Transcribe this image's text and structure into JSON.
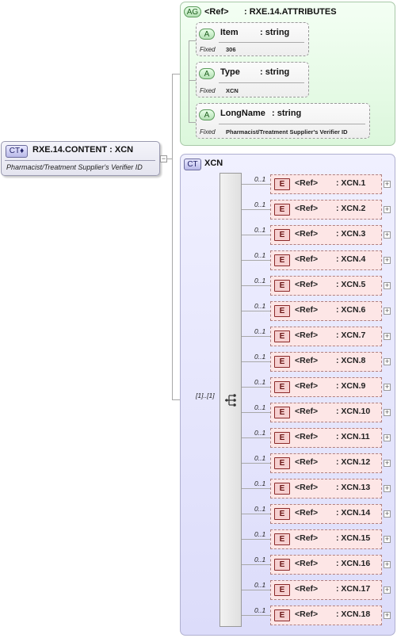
{
  "root": {
    "badge": "CT",
    "title": "RXE.14.CONTENT : XCN",
    "description": "Pharmacist/Treatment Supplier's Verifier ID"
  },
  "attribute_group": {
    "badge": "AG",
    "ref": "<Ref>",
    "name": ": RXE.14.ATTRIBUTES",
    "attributes": [
      {
        "badge": "A",
        "name": "Item",
        "type": ": string",
        "fixed_label": "Fixed",
        "fixed_value": "306"
      },
      {
        "badge": "A",
        "name": "Type",
        "type": ": string",
        "fixed_label": "Fixed",
        "fixed_value": "XCN"
      },
      {
        "badge": "A",
        "name": "LongName",
        "type": ": string",
        "fixed_label": "Fixed",
        "fixed_value": "Pharmacist/Treatment Supplier's Verifier ID"
      }
    ]
  },
  "complex_type": {
    "badge": "CT",
    "name": "XCN",
    "sequence_occurrence": "[1]..[1]",
    "elements": [
      {
        "badge": "E",
        "ref": "<Ref>",
        "type": ": XCN.1",
        "occurrence": "0..1"
      },
      {
        "badge": "E",
        "ref": "<Ref>",
        "type": ": XCN.2",
        "occurrence": "0..1"
      },
      {
        "badge": "E",
        "ref": "<Ref>",
        "type": ": XCN.3",
        "occurrence": "0..1"
      },
      {
        "badge": "E",
        "ref": "<Ref>",
        "type": ": XCN.4",
        "occurrence": "0..1"
      },
      {
        "badge": "E",
        "ref": "<Ref>",
        "type": ": XCN.5",
        "occurrence": "0..1"
      },
      {
        "badge": "E",
        "ref": "<Ref>",
        "type": ": XCN.6",
        "occurrence": "0..1"
      },
      {
        "badge": "E",
        "ref": "<Ref>",
        "type": ": XCN.7",
        "occurrence": "0..1"
      },
      {
        "badge": "E",
        "ref": "<Ref>",
        "type": ": XCN.8",
        "occurrence": "0..1"
      },
      {
        "badge": "E",
        "ref": "<Ref>",
        "type": ": XCN.9",
        "occurrence": "0..1"
      },
      {
        "badge": "E",
        "ref": "<Ref>",
        "type": ": XCN.10",
        "occurrence": "0..1"
      },
      {
        "badge": "E",
        "ref": "<Ref>",
        "type": ": XCN.11",
        "occurrence": "0..1"
      },
      {
        "badge": "E",
        "ref": "<Ref>",
        "type": ": XCN.12",
        "occurrence": "0..1"
      },
      {
        "badge": "E",
        "ref": "<Ref>",
        "type": ": XCN.13",
        "occurrence": "0..1"
      },
      {
        "badge": "E",
        "ref": "<Ref>",
        "type": ": XCN.14",
        "occurrence": "0..1"
      },
      {
        "badge": "E",
        "ref": "<Ref>",
        "type": ": XCN.15",
        "occurrence": "0..1"
      },
      {
        "badge": "E",
        "ref": "<Ref>",
        "type": ": XCN.16",
        "occurrence": "0..1"
      },
      {
        "badge": "E",
        "ref": "<Ref>",
        "type": ": XCN.17",
        "occurrence": "0..1"
      },
      {
        "badge": "E",
        "ref": "<Ref>",
        "type": ": XCN.18",
        "occurrence": "0..1"
      }
    ]
  },
  "icons": {
    "expand": "+",
    "collapse": "−",
    "sequence": "sequence-icon"
  }
}
